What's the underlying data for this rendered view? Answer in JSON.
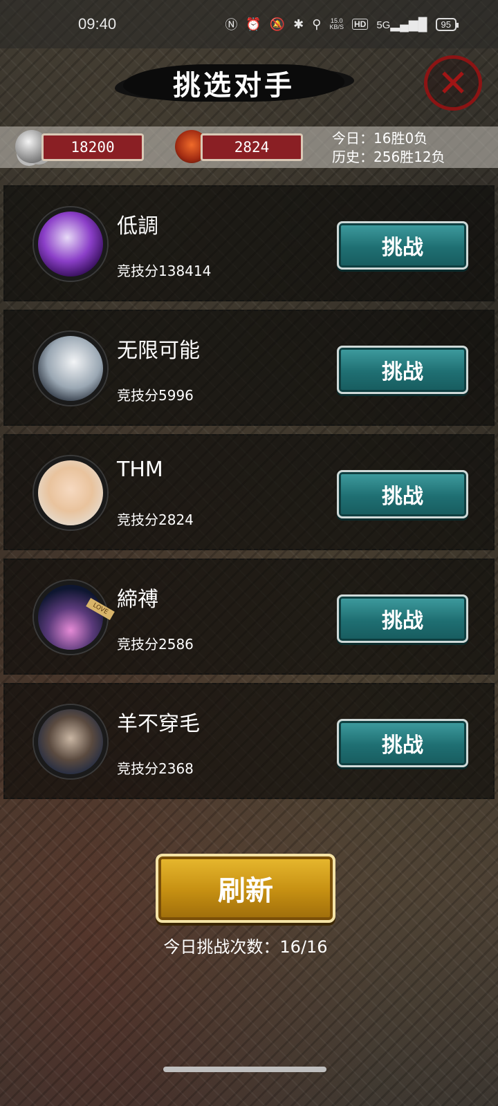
{
  "status_bar": {
    "time": "09:40",
    "net_speed_value": "15.0",
    "net_speed_unit": "KB/S",
    "hd": "HD",
    "signal": "5G",
    "battery": "95"
  },
  "header": {
    "title": "挑选对手",
    "close_icon": "close-x-icon"
  },
  "resources": {
    "coins": "18200",
    "coin_icon": "silver-coins-icon",
    "rank_points": "2824",
    "rank_icon": "demon-mask-icon",
    "today_label": "今日：16胜0负",
    "history_label": "历史：256胜12负"
  },
  "opponents": [
    {
      "name": "低調",
      "score": "竞技分138414",
      "button": "挑战",
      "avatar": "purple-palace-avatar"
    },
    {
      "name": "无限可能",
      "score": "竞技分5996",
      "button": "挑战",
      "avatar": "swordsman-avatar"
    },
    {
      "name": "THM",
      "score": "竞技分2824",
      "button": "挑战",
      "avatar": "baby-avatar"
    },
    {
      "name": "締禣",
      "score": "竞技分2586",
      "button": "挑战",
      "avatar": "love-bottle-avatar",
      "avatar_tag": "LOVE"
    },
    {
      "name": "羊不穿毛",
      "score": "竞技分2368",
      "button": "挑战",
      "avatar": "selfie-man-avatar"
    }
  ],
  "footer": {
    "refresh": "刷新",
    "attempts": "今日挑战次数：16/16"
  },
  "colors": {
    "challenge_button": "#1f6f72",
    "refresh_button": "#c58f12",
    "resource_box": "#8a1f24",
    "close_red": "#a11515"
  }
}
